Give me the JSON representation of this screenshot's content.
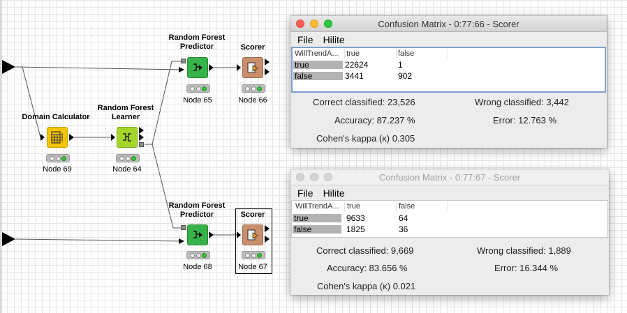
{
  "workflow": {
    "nodes": {
      "domain_calculator": {
        "title": "Domain Calculator",
        "label": "Node 69"
      },
      "rf_learner": {
        "title": "Random Forest\nLearner",
        "label": "Node 64"
      },
      "rf_predictor_top": {
        "title": "Random Forest\nPredictor",
        "label": "Node 65"
      },
      "scorer_top": {
        "title": "Scorer",
        "label": "Node 66"
      },
      "rf_predictor_bottom": {
        "title": "Random Forest\nPredictor",
        "label": "Node 68"
      },
      "scorer_bottom": {
        "title": "Scorer",
        "label": "Node 67"
      }
    }
  },
  "windows": [
    {
      "title": "Confusion Matrix - 0:77:66 - Scorer",
      "menu": [
        "File",
        "Hilite"
      ],
      "table": {
        "headers": [
          "WillTrendA...",
          "true",
          "false"
        ],
        "rows": [
          {
            "label": "true",
            "values": [
              "22624",
              "1"
            ]
          },
          {
            "label": "false",
            "values": [
              "3441",
              "902"
            ]
          }
        ]
      },
      "stats": {
        "correct": "Correct classified: 23,526",
        "wrong": "Wrong classified: 3,442",
        "accuracy": "Accuracy: 87.237 %",
        "error": "Error: 12.763 %",
        "kappa": "Cohen's kappa (κ) 0.305"
      }
    },
    {
      "title": "Confusion Matrix - 0:77:67 - Scorer",
      "menu": [
        "File",
        "Hilite"
      ],
      "table": {
        "headers": [
          "WillTrendA...",
          "true",
          "false"
        ],
        "rows": [
          {
            "label": "true",
            "values": [
              "9633",
              "64"
            ]
          },
          {
            "label": "false",
            "values": [
              "1825",
              "36"
            ]
          }
        ]
      },
      "stats": {
        "correct": "Correct classified: 9,669",
        "wrong": "Wrong classified: 1,889",
        "accuracy": "Accuracy: 83.656 %",
        "error": "Error: 16.344 %",
        "kappa": "Cohen's kappa (κ) 0.021"
      }
    }
  ],
  "colors": {
    "predictor_green": "#38b34a",
    "learner_lime": "#a5d62a",
    "domain_yellow": "#f5c400",
    "scorer_brown": "#c98e6b"
  }
}
